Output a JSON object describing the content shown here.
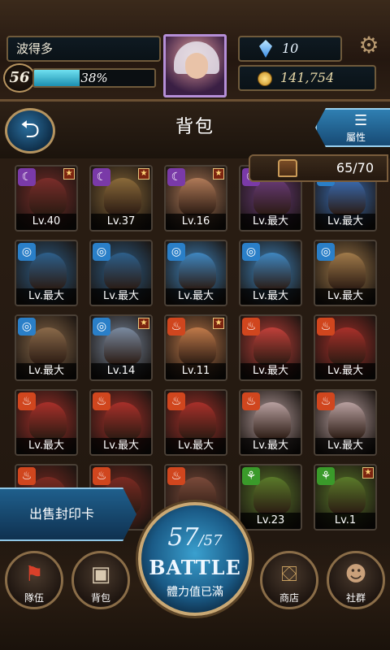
{
  "player": {
    "name": "波得多",
    "level": "56",
    "exp_percent": 38,
    "exp_text": "38%",
    "gems": "10",
    "coins": "141,754"
  },
  "titlebar": {
    "title": "背包",
    "attribute_label": "屬性",
    "attribute_icon": "list-icon"
  },
  "inventory": {
    "count": "65/70",
    "cards": [
      {
        "element": "dark",
        "level": "Lv.40",
        "rare": true,
        "color": "#7a2d2a"
      },
      {
        "element": "dark",
        "level": "Lv.37",
        "rare": true,
        "color": "#8a6a3a"
      },
      {
        "element": "dark",
        "level": "Lv.16",
        "rare": true,
        "color": "#b07a58"
      },
      {
        "element": "dark",
        "level": "Lv.最大",
        "rare": false,
        "color": "#6a3b7a"
      },
      {
        "element": "water",
        "level": "Lv.最大",
        "rare": false,
        "color": "#3a6fb8"
      },
      {
        "element": "water",
        "level": "Lv.最大",
        "rare": false,
        "color": "#2d5f8a"
      },
      {
        "element": "water",
        "level": "Lv.最大",
        "rare": false,
        "color": "#2d5f8a"
      },
      {
        "element": "water",
        "level": "Lv.最大",
        "rare": false,
        "color": "#3f86c0"
      },
      {
        "element": "water",
        "level": "Lv.最大",
        "rare": false,
        "color": "#3f86c0"
      },
      {
        "element": "water",
        "level": "Lv.最大",
        "rare": false,
        "color": "#a07a4a"
      },
      {
        "element": "water",
        "level": "Lv.最大",
        "rare": false,
        "color": "#8a6a4a"
      },
      {
        "element": "water",
        "level": "Lv.14",
        "rare": true,
        "color": "#7a8aa0"
      },
      {
        "element": "fire",
        "level": "Lv.11",
        "rare": true,
        "color": "#c07a4a"
      },
      {
        "element": "fire",
        "level": "Lv.最大",
        "rare": false,
        "color": "#c0403a"
      },
      {
        "element": "fire",
        "level": "Lv.最大",
        "rare": false,
        "color": "#a8302a"
      },
      {
        "element": "fire",
        "level": "Lv.最大",
        "rare": false,
        "color": "#a8302a"
      },
      {
        "element": "fire",
        "level": "Lv.最大",
        "rare": false,
        "color": "#a8302a"
      },
      {
        "element": "fire",
        "level": "Lv.最大",
        "rare": false,
        "color": "#a8302a"
      },
      {
        "element": "fire",
        "level": "Lv.最大",
        "rare": false,
        "color": "#b8a0a0"
      },
      {
        "element": "fire",
        "level": "Lv.最大",
        "rare": false,
        "color": "#b8a0a0"
      },
      {
        "element": "fire",
        "level": "",
        "rare": false,
        "color": "#7a2a22"
      },
      {
        "element": "fire",
        "level": "",
        "rare": false,
        "color": "#7a2a22"
      },
      {
        "element": "fire",
        "level": "",
        "rare": false,
        "color": "#7a4a3a"
      },
      {
        "element": "wood",
        "level": "Lv.23",
        "rare": false,
        "color": "#5a7a2a"
      },
      {
        "element": "wood",
        "level": "Lv.1",
        "rare": true,
        "color": "#5a7a2a"
      }
    ]
  },
  "actions": {
    "sell_label": "出售封印卡"
  },
  "battle": {
    "stamina_current": "57",
    "stamina_max": "/57",
    "label": "BATTLE",
    "status": "體力值已滿"
  },
  "nav": [
    {
      "label": "隊伍",
      "icon": "flag-icon"
    },
    {
      "label": "背包",
      "icon": "bag-icon"
    },
    {
      "label": "商店",
      "icon": "chest-icon"
    },
    {
      "label": "社群",
      "icon": "people-icon"
    }
  ],
  "colors": {
    "dark": "#7a3aa8",
    "water": "#2a7fc8",
    "fire": "#d0461e",
    "wood": "#3a9a2a"
  }
}
